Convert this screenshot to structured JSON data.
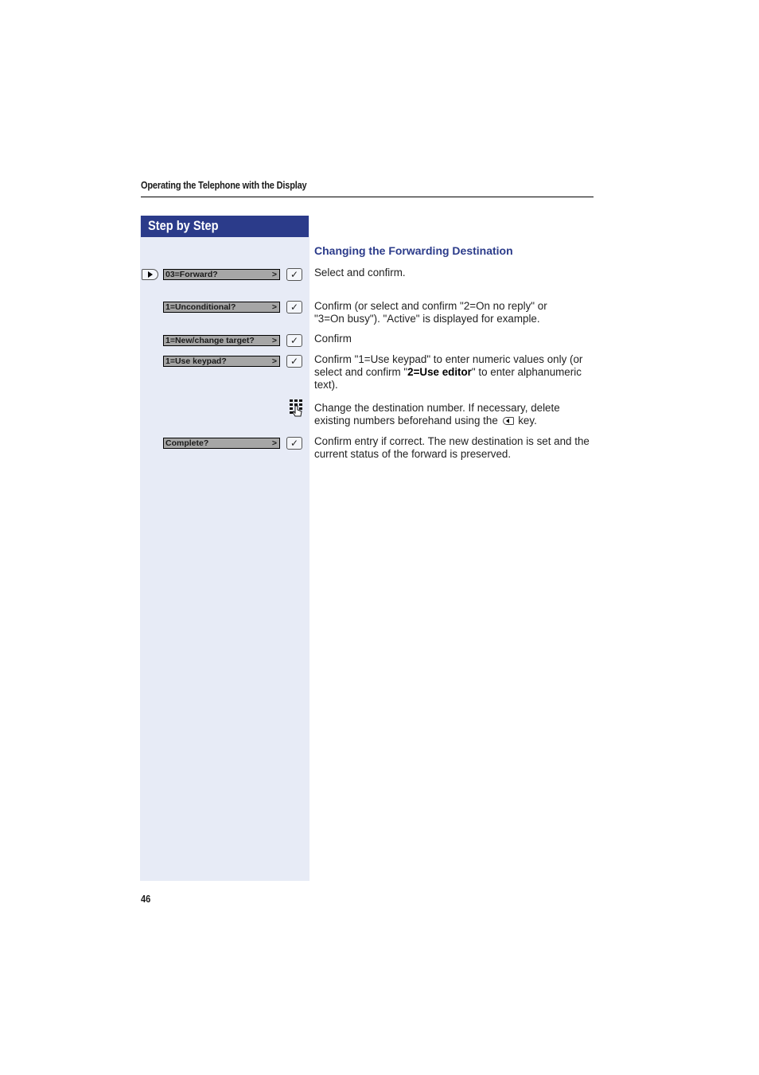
{
  "header": {
    "running_title": "Operating the Telephone with the Display"
  },
  "sidebar": {
    "title": "Step by Step"
  },
  "section": {
    "title": "Changing the Forwarding Destination"
  },
  "steps": [
    {
      "display": "03=Forward?",
      "arrow": ">",
      "icon": "check-key",
      "text": "Select and confirm."
    },
    {
      "display": "1=Unconditional?",
      "arrow": ">",
      "icon": "check-key",
      "text": "Confirm (or select and confirm \"2=On no reply\" or \"3=On busy\"). \"Active\" is displayed for example."
    },
    {
      "display": "1=New/change target?",
      "arrow": ">",
      "icon": "check-key",
      "text": "Confirm"
    },
    {
      "display": "1=Use keypad?",
      "arrow": ">",
      "icon": "check-key",
      "text_pre": "Confirm \"1=Use keypad\" to enter numeric values only (or select and confirm \"",
      "text_bold": "2=Use editor",
      "text_post": "\" to enter alphanumeric text)."
    },
    {
      "icon": "keypad-icon",
      "text_pre": "Change the destination number. If necessary, delete existing numbers beforehand using the ",
      "text_post": " key."
    },
    {
      "display": "Complete?",
      "arrow": ">",
      "icon": "check-key",
      "text": "Confirm entry if correct. The new destination is set and the current status of the forward is preserved."
    }
  ],
  "check_glyph": "✓",
  "footer": {
    "page_number": "46"
  }
}
